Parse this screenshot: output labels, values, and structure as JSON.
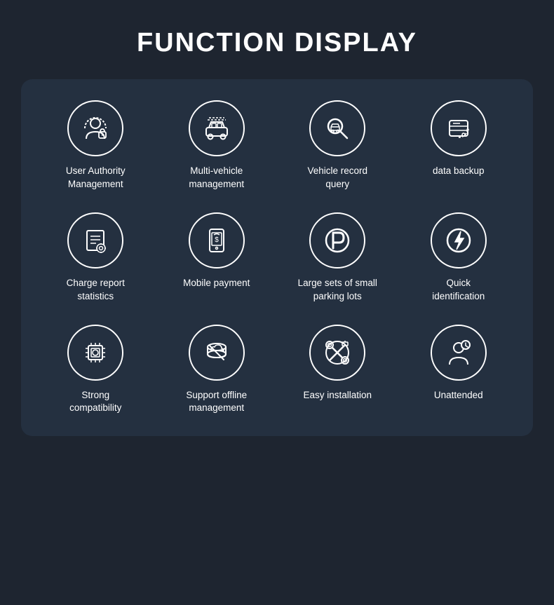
{
  "page": {
    "title": "FUNCTION DISPLAY"
  },
  "features": [
    {
      "id": "user-authority",
      "label": "User Authority\nManagement",
      "icon": "user-authority"
    },
    {
      "id": "multi-vehicle",
      "label": "Multi-vehicle\nmanagement",
      "icon": "multi-vehicle"
    },
    {
      "id": "vehicle-record",
      "label": "Vehicle record\nquery",
      "icon": "vehicle-record"
    },
    {
      "id": "data-backup",
      "label": "data backup",
      "icon": "data-backup"
    },
    {
      "id": "charge-report",
      "label": "Charge report\nstatistics",
      "icon": "charge-report"
    },
    {
      "id": "mobile-payment",
      "label": "Mobile payment",
      "icon": "mobile-payment"
    },
    {
      "id": "parking-lots",
      "label": "Large sets of small\nparking lots",
      "icon": "parking-lots"
    },
    {
      "id": "quick-identification",
      "label": "Quick\nidentification",
      "icon": "quick-identification"
    },
    {
      "id": "strong-compatibility",
      "label": "Strong\ncompatibility",
      "icon": "strong-compatibility"
    },
    {
      "id": "offline-management",
      "label": "Support offline\nmanagement",
      "icon": "offline-management"
    },
    {
      "id": "easy-installation",
      "label": "Easy installation",
      "icon": "easy-installation"
    },
    {
      "id": "unattended",
      "label": "Unattended",
      "icon": "unattended"
    }
  ]
}
